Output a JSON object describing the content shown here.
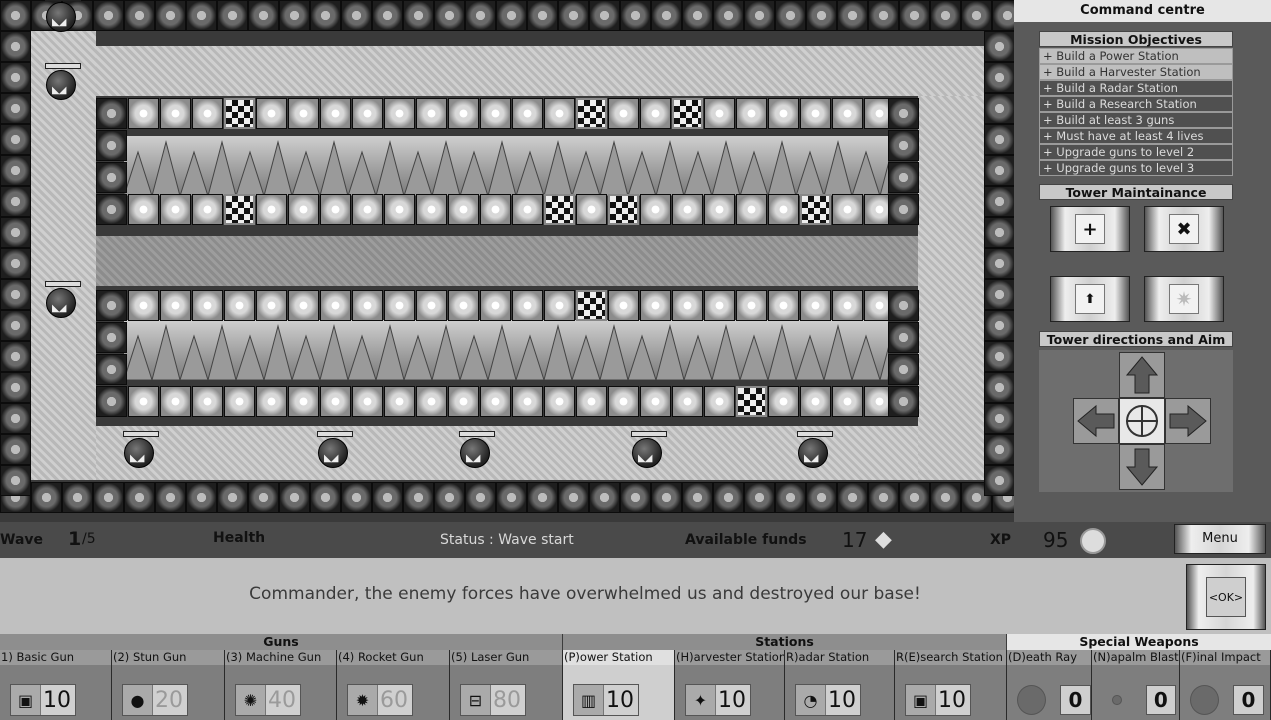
{
  "colors": {
    "background": "#2a2a2a",
    "panel": "#5a5a5a",
    "highlight": "#e6e6e6",
    "message_bg": "#c0c0c0"
  },
  "command_centre": {
    "title": "Command centre",
    "objectives_title": "Mission Objectives",
    "objectives": [
      {
        "label": "+ Build a Power Station",
        "done": true
      },
      {
        "label": "+ Build a Harvester Station",
        "done": true
      },
      {
        "label": "+ Build a Radar Station",
        "done": false
      },
      {
        "label": "+ Build a Research Station",
        "done": false
      },
      {
        "label": "+ Build at least 3 guns",
        "done": false
      },
      {
        "label": "+ Must have at least 4 lives",
        "done": false
      },
      {
        "label": "+ Upgrade guns to level 2",
        "done": false
      },
      {
        "label": "+ Upgrade guns to level 3",
        "done": false
      }
    ],
    "maintenance_title": "Tower Maintainance",
    "maintenance_icons": [
      "plus-icon",
      "close-icon",
      "upgrade-arrow-icon",
      "explosion-icon"
    ],
    "aim_title": "Tower directions and Aim",
    "aim_icons": [
      "arrow-up-icon",
      "arrow-left-icon",
      "crosshair-icon",
      "arrow-right-icon",
      "arrow-down-icon"
    ]
  },
  "status": {
    "wave_label": "Wave",
    "wave_current": "1",
    "wave_total": "/5",
    "health_label": "Health",
    "status_text": "Status : Wave start",
    "funds_label": "Available funds",
    "funds_value": "17",
    "funds_icon": "diamond-icon",
    "xp_label": "XP",
    "xp_value": "95",
    "xp_icon": "xp-coin-icon",
    "menu_label": "Menu"
  },
  "message": {
    "text": "Commander, the enemy forces have overwhelmed us and destroyed our base!",
    "ok_label": "<OK>"
  },
  "build_bar": {
    "groups": [
      {
        "title": "Guns"
      },
      {
        "title": "Stations"
      },
      {
        "title": "Special Weapons"
      }
    ],
    "guns": [
      {
        "label": "1) Basic Gun",
        "cost": "10",
        "icon": "basic-gun-icon",
        "available": true
      },
      {
        "label": "(2) Stun Gun",
        "cost": "20",
        "icon": "stun-gun-icon",
        "available": false
      },
      {
        "label": "(3) Machine Gun",
        "cost": "40",
        "icon": "machine-gun-icon",
        "available": false
      },
      {
        "label": "(4) Rocket Gun",
        "cost": "60",
        "icon": "rocket-gun-icon",
        "available": false
      },
      {
        "label": "(5) Laser Gun",
        "cost": "80",
        "icon": "laser-gun-icon",
        "available": false
      }
    ],
    "stations": [
      {
        "label": "(P)ower Station",
        "cost": "10",
        "icon": "power-station-icon",
        "selected": true
      },
      {
        "label": "(H)arvester Station",
        "cost": "10",
        "icon": "harvester-station-icon",
        "selected": false
      },
      {
        "label": "R)adar Station",
        "cost": "10",
        "icon": "radar-station-icon",
        "selected": false
      },
      {
        "label": "R(E)search Station",
        "cost": "10",
        "icon": "research-station-icon",
        "selected": false
      }
    ],
    "special": [
      {
        "label": "(D)eath Ray",
        "count": "0",
        "icon": "death-ray-icon"
      },
      {
        "label": "(N)apalm Blast",
        "count": "0",
        "icon": "napalm-blast-icon"
      },
      {
        "label": "(F)inal Impact",
        "count": "0",
        "icon": "final-impact-icon"
      }
    ]
  }
}
